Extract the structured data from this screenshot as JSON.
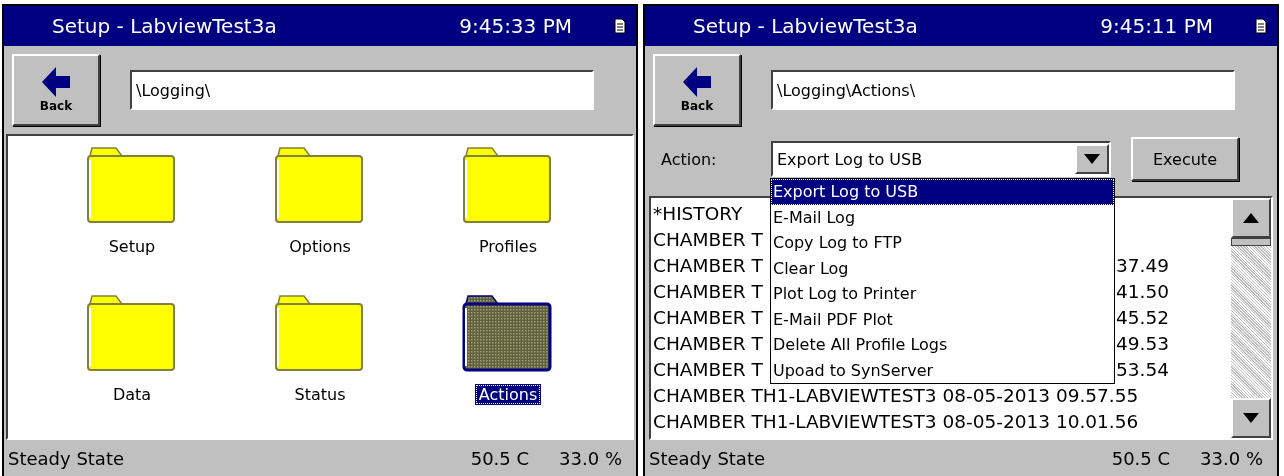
{
  "screens": [
    {
      "kind": "folders",
      "title": "Setup - LabviewTest3a",
      "time": "9:45:33 PM",
      "back_label": "Back",
      "path": "\\Logging\\",
      "folders": [
        {
          "name": "Setup",
          "selected": false
        },
        {
          "name": "Options",
          "selected": false
        },
        {
          "name": "Profiles",
          "selected": false
        },
        {
          "name": "Data",
          "selected": false
        },
        {
          "name": "Status",
          "selected": false
        },
        {
          "name": "Actions",
          "selected": true
        }
      ],
      "status_bar": {
        "state": "Steady State",
        "temperature": "50.5 C",
        "humidity": "33.0 %"
      }
    },
    {
      "kind": "actions",
      "title": "Setup - LabviewTest3a",
      "time": "9:45:11 PM",
      "back_label": "Back",
      "path": "\\Logging\\Actions\\",
      "action_label": "Action:",
      "action_value": "Export Log to USB",
      "execute_label": "Execute",
      "dropdown": [
        {
          "label": "Export Log to USB",
          "selected": true
        },
        {
          "label": "E-Mail Log",
          "selected": false
        },
        {
          "label": "Copy Log to FTP",
          "selected": false
        },
        {
          "label": "Clear Log",
          "selected": false
        },
        {
          "label": "Plot Log to Printer",
          "selected": false
        },
        {
          "label": "E-Mail PDF Plot",
          "selected": false
        },
        {
          "label": "Delete All Profile Logs",
          "selected": false
        },
        {
          "label": "Upoad to SynServer",
          "selected": false
        }
      ],
      "log_rows": [
        {
          "start": "*HISTORY"
        },
        {
          "start": "CHAMBER T"
        },
        {
          "start": "CHAMBER T",
          "end": "37.49"
        },
        {
          "start": "CHAMBER T",
          "end": "41.50"
        },
        {
          "start": "CHAMBER T",
          "end": "45.52"
        },
        {
          "start": "CHAMBER T",
          "end": "49.53"
        },
        {
          "start": "CHAMBER T",
          "end": "53.54"
        },
        {
          "start": "CHAMBER TH1-LABVIEWTEST3 08-05-2013 09.57.55"
        },
        {
          "start": "CHAMBER TH1-LABVIEWTEST3 08-05-2013 10.01.56"
        }
      ],
      "status_bar": {
        "state": "Steady State",
        "temperature": "50.5 C",
        "humidity": "33.0 %"
      }
    }
  ]
}
